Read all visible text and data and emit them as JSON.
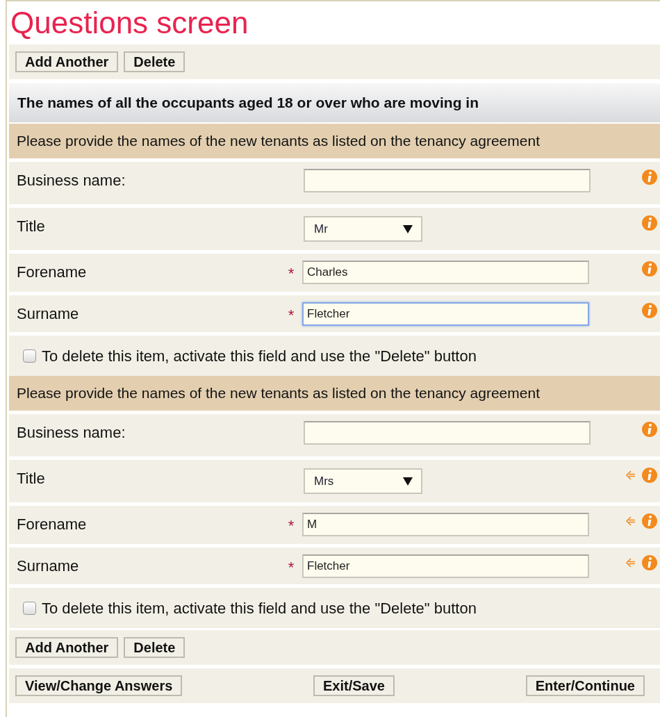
{
  "title": "Questions screen",
  "top_toolbar": {
    "buttons": [
      "Add Another",
      "Delete"
    ]
  },
  "question": "The names of all the occupants aged 18 or over who are moving in",
  "groups": [
    {
      "instruction": "Please provide the names of the new tenants as listed on the tenancy agreement",
      "fields": [
        {
          "label": "Business name:",
          "kind": "text",
          "focused": false,
          "changed": false
        },
        {
          "label": "Title",
          "kind": "select",
          "value": "Mr",
          "changed": false
        },
        {
          "label": "Forename",
          "kind": "text",
          "required_mark": "*",
          "value": "Charles",
          "focused": false,
          "changed": false
        },
        {
          "label": "Surname",
          "kind": "text",
          "required_mark": "*",
          "value": "Fletcher",
          "focused": true,
          "changed": false
        }
      ],
      "delete_option": {
        "label": "To delete this item, activate this field and use the \"Delete\" button",
        "checked": false
      }
    },
    {
      "instruction": "Please provide the names of the new tenants as listed on the tenancy agreement",
      "fields": [
        {
          "label": "Business name:",
          "kind": "text",
          "focused": false,
          "changed": false
        },
        {
          "label": "Title",
          "kind": "select",
          "value": "Mrs",
          "changed": true
        },
        {
          "label": "Forename",
          "kind": "text",
          "required_mark": "*",
          "value": "M",
          "focused": false,
          "changed": true
        },
        {
          "label": "Surname",
          "kind": "text",
          "required_mark": "*",
          "value": "Fletcher",
          "focused": false,
          "changed": true
        }
      ],
      "delete_option": {
        "label": "To delete this item, activate this field and use the \"Delete\" button",
        "checked": false
      }
    }
  ],
  "bottom_toolbar": {
    "buttons": [
      "Add Another",
      "Delete"
    ]
  },
  "footer_buttons": [
    "View/Change Answers",
    "Exit/Save",
    "Enter/Continue"
  ]
}
